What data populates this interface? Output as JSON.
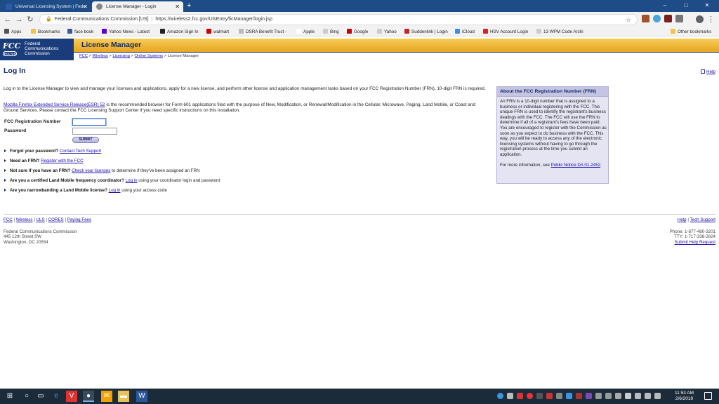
{
  "browser": {
    "tabs": [
      {
        "title": "Universal Licensing System | Fede",
        "active": false
      },
      {
        "title": "License Manager - Login",
        "active": true
      }
    ],
    "new_tab_label": "+",
    "window_controls": [
      "–",
      "□",
      "✕"
    ],
    "address": {
      "site_name": "Federal Communications Commission [US]",
      "url": "https://wireless2.fcc.gov/UlsEntry/licManager/login.jsp"
    },
    "bookmarks": [
      {
        "label": "Apps",
        "color": "#555555"
      },
      {
        "label": "Bookmarks",
        "color": "#f5c342"
      },
      {
        "label": "face book",
        "color": "#3b5998"
      },
      {
        "label": "Yahoo News - Latest",
        "color": "#5f01d1"
      },
      {
        "label": "Amazon Sign In",
        "color": "#222222"
      },
      {
        "label": "walmart",
        "color": "#cc0000"
      },
      {
        "label": "DSRA Benefit Trust -",
        "color": "#888888"
      },
      {
        "label": "Apple",
        "color": "#999999"
      },
      {
        "label": "Bing",
        "color": "#888888"
      },
      {
        "label": "Google",
        "color": "#cc0000"
      },
      {
        "label": "Yahoo",
        "color": "#888888"
      },
      {
        "label": "Suddenlink | Login",
        "color": "#c4262e"
      },
      {
        "label": "iCloud",
        "color": "#3a8ee6"
      },
      {
        "label": "HSV Account Login",
        "color": "#e02020"
      },
      {
        "label": "13 WPM Code Archi",
        "color": "#888888"
      }
    ],
    "other_bookmarks": "Other bookmarks"
  },
  "fcc": {
    "logo_mark": "FCC",
    "logo_sub": "FCC·US",
    "logo_text": [
      "Federal",
      "Communications",
      "Commission"
    ],
    "app_title": "License Manager",
    "breadcrumbs": [
      "FCC",
      "Wireless",
      "Licensing",
      "Online Systems"
    ],
    "breadcrumb_current": "License Manager",
    "breadcrumb_sep": " > "
  },
  "page": {
    "title": "Log In",
    "help_link": "Help",
    "intro": "Log in to the License Manager to view and manage your licenses and applications, apply for a new license, and perform other license and application management tasks based on your FCC Registration Number (FRN), 10-digit FRN is required.",
    "browser_note_link": "Mozilla Firefox Extended Service Release(ESR) 52",
    "browser_note_text": " is the recommended browser for Form 601 applications filed with the purpose of New, Modification, or Renewal/Modification in the Cellular, Microwave, Paging, Land Mobile, or Coast and Ground Services. Please contact the FCC Licensing Support Center if you need specific instructions on this installation.",
    "frn_label": "FCC Registration Number",
    "frn_value": "",
    "password_label": "Password",
    "password_value": "",
    "submit_label": "SUBMIT",
    "questions": [
      {
        "bold": "Forgot your password?",
        "link": "Contact Tech Support",
        "after": ""
      },
      {
        "bold": "Need an FRN?",
        "link": "Register with the FCC",
        "after": ""
      },
      {
        "bold": "Not sure if you have an FRN?",
        "link": "Check your licenses",
        "after": " to determine if they've been assigned an FRN"
      },
      {
        "bold": "Are you a certified Land Mobile frequency coordinator?",
        "link": "Log in",
        "after": " using your coordinator login and password"
      },
      {
        "bold": "Are you narrowbanding a Land Mobile license?",
        "link": "Log in",
        "after": " using your access code"
      }
    ]
  },
  "sidebox": {
    "title": "About the FCC Registration Number (FRN)",
    "body": "An FRN is a 10-digit number that is assigned to a business or individual registering with the FCC. This unique FRN is used to identify the registrant's business dealings with the FCC. The FCC will use the FRN to determine if all of a registrant's fees have been paid. You are encouraged to register with the Commission as soon as you expect to do business with the FCC. This way, you will be ready to access any of the electronic licensing systems without having to go through the registration process at the time you submit an application.",
    "more_prefix": "For more information, see ",
    "more_link": "Public Notice DA 01-2452",
    "more_suffix": "."
  },
  "footer": {
    "links": [
      "FCC",
      "Wireless",
      "ULS",
      "CORES",
      "Paying Fees"
    ],
    "right_links": [
      "Help",
      "Tech Support"
    ],
    "address": [
      "Federal Communications Commission",
      "445 12th Street SW",
      "Washington, DC 20554"
    ],
    "phone": "Phone: 1-877-480-3201",
    "tty": "TTY: 1-717-338-2824",
    "submit_help": "Submit Help Request"
  },
  "taskbar": {
    "time": "11:53 AM",
    "date": "2/6/2019"
  }
}
